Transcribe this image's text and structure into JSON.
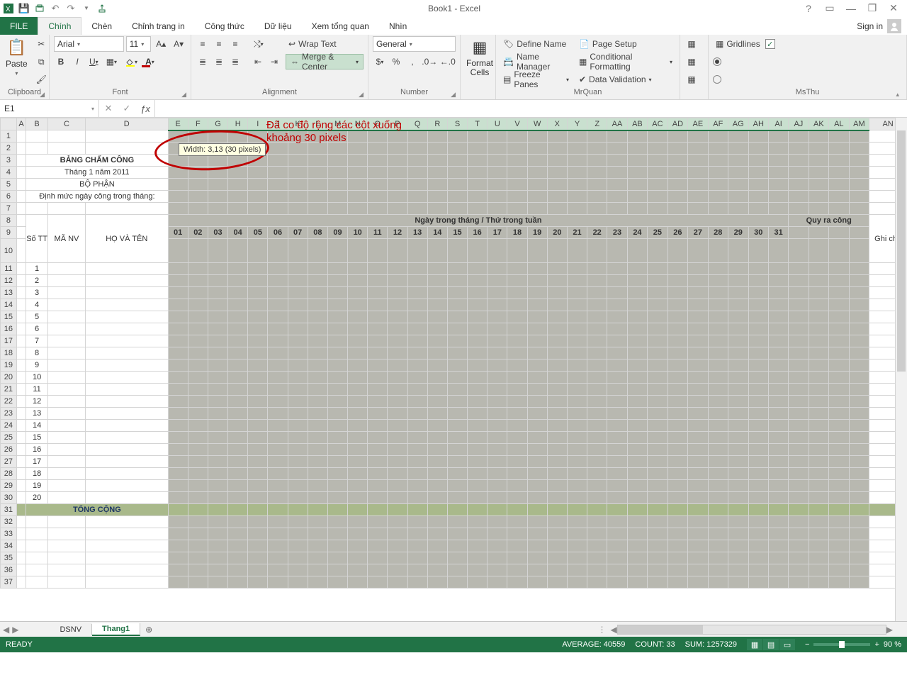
{
  "title": "Book1 - Excel",
  "qat": {
    "save": "💾",
    "undo": "↶",
    "redo": "↷"
  },
  "win": {
    "help": "?",
    "ribopt": "▭",
    "min": "—",
    "max": "❐",
    "close": "✕"
  },
  "signin": "Sign in",
  "tabs": {
    "file": "FILE",
    "list": [
      "Chính",
      "Chèn",
      "Chỉnh trang in",
      "Công thức",
      "Dữ liệu",
      "Xem tổng quan",
      "Nhìn"
    ],
    "active": 0
  },
  "ribbon": {
    "clipboard": {
      "paste": "Paste",
      "label": "Clipboard"
    },
    "font": {
      "name": "Arial",
      "size": "11",
      "bold": "B",
      "italic": "I",
      "underline": "U",
      "label": "Font"
    },
    "align": {
      "wrap": "Wrap Text",
      "merge": "Merge & Center",
      "label": "Alignment"
    },
    "number": {
      "format": "General",
      "label": "Number"
    },
    "cells": {
      "format": "Format\nCells"
    },
    "mrquan": {
      "define": "Define Name",
      "nmgr": "Name Manager",
      "freeze": "Freeze Panes",
      "pagesetup": "Page Setup",
      "condfmt": "Conditional Formatting",
      "dataval": "Data Validation",
      "label": "MrQuan"
    },
    "msthu": {
      "gridlines": "Gridlines",
      "label": "MsThu"
    }
  },
  "namebox": "E1",
  "fx": "ƒx",
  "annot": {
    "l1": "Đã co độ rộng các cột xuống",
    "l2": "khoảng 30 pixels"
  },
  "tooltip": "Width: 3,13 (30 pixels)",
  "cols": [
    "A",
    "B",
    "C",
    "D",
    "E",
    "F",
    "G",
    "H",
    "I",
    "J",
    "K",
    "L",
    "M",
    "N",
    "O",
    "P",
    "Q",
    "R",
    "S",
    "T",
    "U",
    "V",
    "W",
    "X",
    "Y",
    "Z",
    "AA",
    "AB",
    "AC",
    "AD",
    "AE",
    "AF",
    "AG",
    "AH",
    "AI",
    "AJ",
    "AK",
    "AL",
    "AM",
    "AN"
  ],
  "rows_head": [
    "1",
    "2",
    "3",
    "4",
    "5",
    "6",
    "7",
    "8",
    "9",
    "10",
    "11",
    "12",
    "13",
    "14",
    "15",
    "16",
    "17",
    "18",
    "19",
    "20",
    "21",
    "22",
    "23",
    "24",
    "25",
    "26",
    "27",
    "28",
    "29",
    "30",
    "31",
    "32",
    "33",
    "34",
    "35",
    "36",
    "37"
  ],
  "sheet": {
    "title": "BẢNG CHẤM CÔNG",
    "month": "Tháng 1 năm 2011",
    "dept": "BỘ PHẬN",
    "norm": "Định mức ngày công trong tháng:",
    "h_stt": "Số TT",
    "h_manv": "MÃ NV",
    "h_hoten": "HỌ VÀ TÊN",
    "h_ngay": "Ngày trong tháng / Thứ trong tuần",
    "h_quyra": "Quy ra công",
    "h_ghichu": "Ghi chú",
    "days": [
      "01",
      "02",
      "03",
      "04",
      "05",
      "06",
      "07",
      "08",
      "09",
      "10",
      "11",
      "12",
      "13",
      "14",
      "15",
      "16",
      "17",
      "18",
      "19",
      "20",
      "21",
      "22",
      "23",
      "24",
      "25",
      "26",
      "27",
      "28",
      "29",
      "30",
      "31"
    ],
    "seq": [
      "1",
      "2",
      "3",
      "4",
      "5",
      "6",
      "7",
      "8",
      "9",
      "10",
      "11",
      "12",
      "13",
      "14",
      "15",
      "16",
      "17",
      "18",
      "19",
      "20"
    ],
    "total": "TỔNG CỘNG"
  },
  "sheettabs": {
    "list": [
      "DSNV",
      "Thang1"
    ],
    "active": 1,
    "add": "⊕"
  },
  "status": {
    "ready": "READY",
    "avg": "AVERAGE: 40559",
    "count": "COUNT: 33",
    "sum": "SUM: 1257329",
    "zoom": "90 %"
  }
}
